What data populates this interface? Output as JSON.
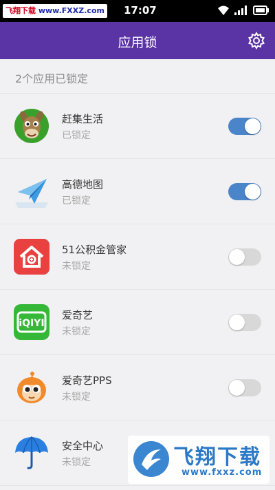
{
  "status_bar": {
    "badge_site_cn": "飞翔下载",
    "badge_site_url": " www.FXXZ.com",
    "time": "17:07",
    "icons": [
      "wifi-icon",
      "signal-icon",
      "battery-icon"
    ]
  },
  "header": {
    "title": "应用锁",
    "settings_icon": "gear-icon",
    "color": "#5a33a5"
  },
  "summary": "2个应用已锁定",
  "apps": [
    {
      "name": "赶集生活",
      "status": "已锁定",
      "locked": true,
      "icon": "ganji-donkey-icon"
    },
    {
      "name": "高德地图",
      "status": "已锁定",
      "locked": true,
      "icon": "amap-paper-plane-icon"
    },
    {
      "name": "51公积金管家",
      "status": "未锁定",
      "locked": false,
      "icon": "house-fund-icon"
    },
    {
      "name": "爱奇艺",
      "status": "未锁定",
      "locked": false,
      "icon": "iqiyi-icon"
    },
    {
      "name": "爱奇艺PPS",
      "status": "未锁定",
      "locked": false,
      "icon": "pps-mascot-icon"
    },
    {
      "name": "安全中心",
      "status": "未锁定",
      "locked": false,
      "icon": "security-umbrella-icon"
    }
  ],
  "toggle_colors": {
    "on": "#4a84c9",
    "off": "#d8d8d8"
  },
  "watermark": {
    "text_cn": "飞翔下载",
    "url": "www.fxxz.com"
  }
}
